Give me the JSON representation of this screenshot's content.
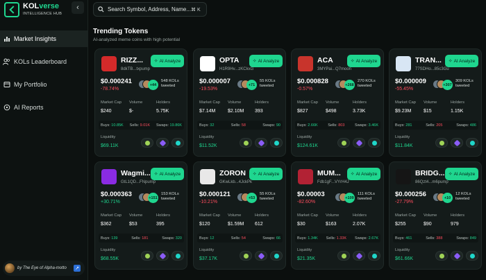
{
  "brand": {
    "name_main": "KOL",
    "name_accent": "verse",
    "subtitle": "INTELLIGENCE HUB"
  },
  "sidebar": {
    "items": [
      {
        "label": "Market Insights",
        "icon": "bar-chart-icon",
        "active": true
      },
      {
        "label": "KOLs Leaderboard",
        "icon": "users-icon",
        "active": false
      },
      {
        "label": "My Portfolio",
        "icon": "portfolio-icon",
        "active": false
      },
      {
        "label": "AI Reports",
        "icon": "ai-icon",
        "active": false
      }
    ],
    "user": {
      "name": "by The Eye of Alpha-motto"
    }
  },
  "search": {
    "placeholder": "Search Symbol, Address, Name...",
    "shortcut": "⌘ K"
  },
  "section": {
    "title": "Trending Tokens",
    "subtitle": "AI-analyzed meme coins with high potential"
  },
  "labels": {
    "ai_analyze": "AI Analyze",
    "market_cap": "Market Cap",
    "volume": "Volume",
    "holders": "Holders",
    "liquidity": "Liquidity",
    "kols_suffix": "KOLs",
    "tweeted": "tweeted",
    "buys": "Buys:",
    "sells": "Sells:",
    "swaps": "Swaps:"
  },
  "tokens": [
    {
      "name": "RIZZ...",
      "address": "8dkTB...txpump",
      "price": "$0.000241",
      "change": "-78.74%",
      "dir": "neg",
      "kol_count": "+44",
      "kols": "548 KOLs",
      "market_cap": "$240",
      "volume": "$-",
      "holders": "5.75K",
      "buys": "10.85K",
      "sells": "9.01K",
      "swaps": "19.86K",
      "liquidity": "$69.11K",
      "img_color": "#d42a2a"
    },
    {
      "name": "OPTA",
      "address": "H1R9Hv...zKCkxG",
      "price": "$0.000007",
      "change": "-19.53%",
      "dir": "neg",
      "kol_count": "+71",
      "kols": "55 KOLs",
      "market_cap": "$7.14M",
      "volume": "$2.10M",
      "holders": "393",
      "buys": "32",
      "sells": "58",
      "swaps": "90",
      "liquidity": "$11.52K",
      "img_color": "#ffffff"
    },
    {
      "name": "ACA",
      "address": "3MYPai...Q7moon",
      "price": "$0.000828",
      "change": "-0.57%",
      "dir": "neg",
      "kol_count": "+268",
      "kols": "270 KOLs",
      "market_cap": "$827",
      "volume": "$498",
      "holders": "3.73K",
      "buys": "2.66K",
      "sells": "803",
      "swaps": "3.46K",
      "liquidity": "$124.61K",
      "img_color": "#c8342c"
    },
    {
      "name": "TRAN...",
      "address": "77SDHo...85c3Gu",
      "price": "$0.000009",
      "change": "-55.45%",
      "dir": "neg",
      "kol_count": "+307",
      "kols": "309 KOLs",
      "market_cap": "$9.23M",
      "volume": "$15",
      "holders": "1.15K",
      "buys": "281",
      "sells": "205",
      "swaps": "486",
      "liquidity": "$11.84K",
      "img_color": "#d8e6f4"
    },
    {
      "name": "Wagmi...",
      "address": "GtL1QD...FNpump",
      "price": "$0.000363",
      "change": "+30.71%",
      "dir": "pos",
      "kol_count": "+151",
      "kols": "153 KOLs",
      "market_cap": "$362",
      "volume": "$53",
      "holders": "395",
      "buys": "139",
      "sells": "181",
      "swaps": "320",
      "liquidity": "$68.55K",
      "img_color": "#8a2be2"
    },
    {
      "name": "ZORON",
      "address": "GKwLkb...4JckPk",
      "price": "$0.000121",
      "change": "-10.21%",
      "dir": "neg",
      "kol_count": "+53",
      "kols": "55 KOLs",
      "market_cap": "$120",
      "volume": "$1.59M",
      "holders": "612",
      "buys": "12",
      "sells": "54",
      "swaps": "66",
      "liquidity": "$37.17K",
      "img_color": "#e8e8e8"
    },
    {
      "name": "MUM...",
      "address": "Fdb1gF...VYrH4J",
      "price": "$0.00003",
      "change": "-82.60%",
      "dir": "neg",
      "kol_count": "+109",
      "kols": "111 KOLs",
      "market_cap": "$30",
      "volume": "$163",
      "holders": "2.07K",
      "buys": "1.34K",
      "sells": "1.33K",
      "swaps": "2.67K",
      "liquidity": "$21.35K",
      "img_color": "#b22234"
    },
    {
      "name": "BRIDG...",
      "address": "86Qzt4...m6pump",
      "price": "$0.000256",
      "change": "-27.79%",
      "dir": "neg",
      "kol_count": "+10",
      "kols": "12 KOLs",
      "market_cap": "$255",
      "volume": "$90",
      "holders": "979",
      "buys": "461",
      "sells": "388",
      "swaps": "849",
      "liquidity": "$61.66K",
      "img_color": "#151515"
    }
  ],
  "colors": {
    "accent": "#1fd68f",
    "negative": "#ff4d5e",
    "card_bg": "#141b1a"
  }
}
